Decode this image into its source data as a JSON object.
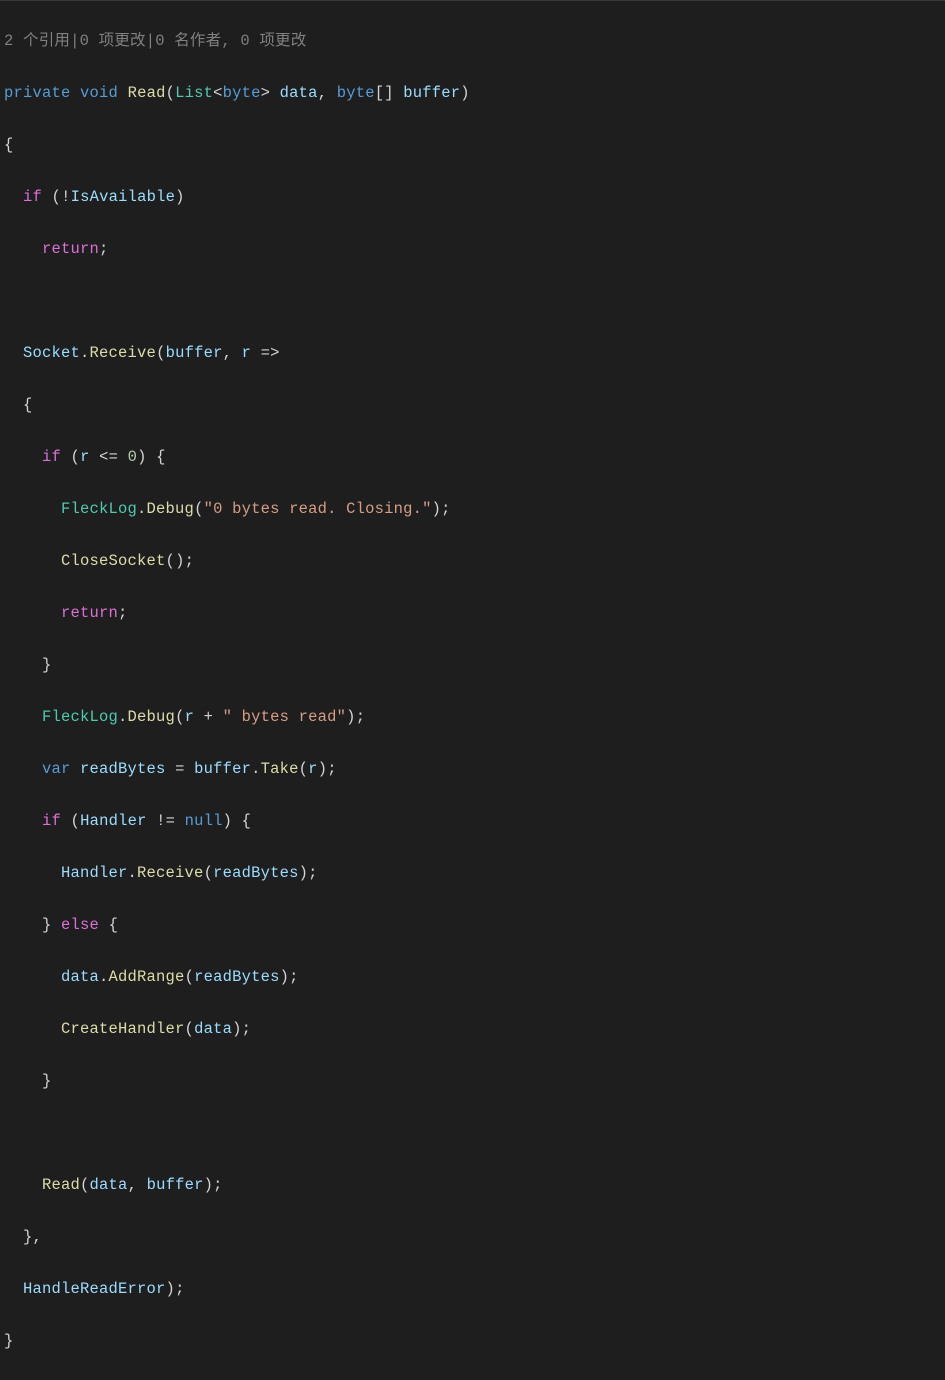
{
  "codelens": "2 个引用|0 项更改|0 名作者, 0 项更改",
  "t": {
    "private": "private",
    "void": "void",
    "Read": "Read",
    "List": "List",
    "byte": "byte",
    "data": "data",
    "buffer": "buffer",
    "if": "if",
    "bang": "!",
    "IsAvailable": "IsAvailable",
    "return": "return",
    "Socket": "Socket",
    "Receive": "Receive",
    "r": "r",
    "arrow": "=>",
    "lteq": "<=",
    "zero": "0",
    "FleckLog": "FleckLog",
    "Debug": "Debug",
    "str_zero": "\"0 bytes read. Closing.\"",
    "CloseSocket": "CloseSocket",
    "plus": "+",
    "str_bytesread": "\" bytes read\"",
    "var": "var",
    "readBytes": "readBytes",
    "eq": "=",
    "Take": "Take",
    "Handler": "Handler",
    "neq": "!=",
    "null": "null",
    "else": "else",
    "AddRange": "AddRange",
    "CreateHandler": "CreateHandler",
    "HandleReadError": "HandleReadError"
  },
  "p": {
    "lparen": "(",
    "rparen": ")",
    "lbrace": "{",
    "rbrace": "}",
    "semi": ";",
    "comma": ",",
    "lt": "<",
    "gt": ">",
    "lbracket": "[",
    "rbracket": "]",
    "dot": "."
  }
}
